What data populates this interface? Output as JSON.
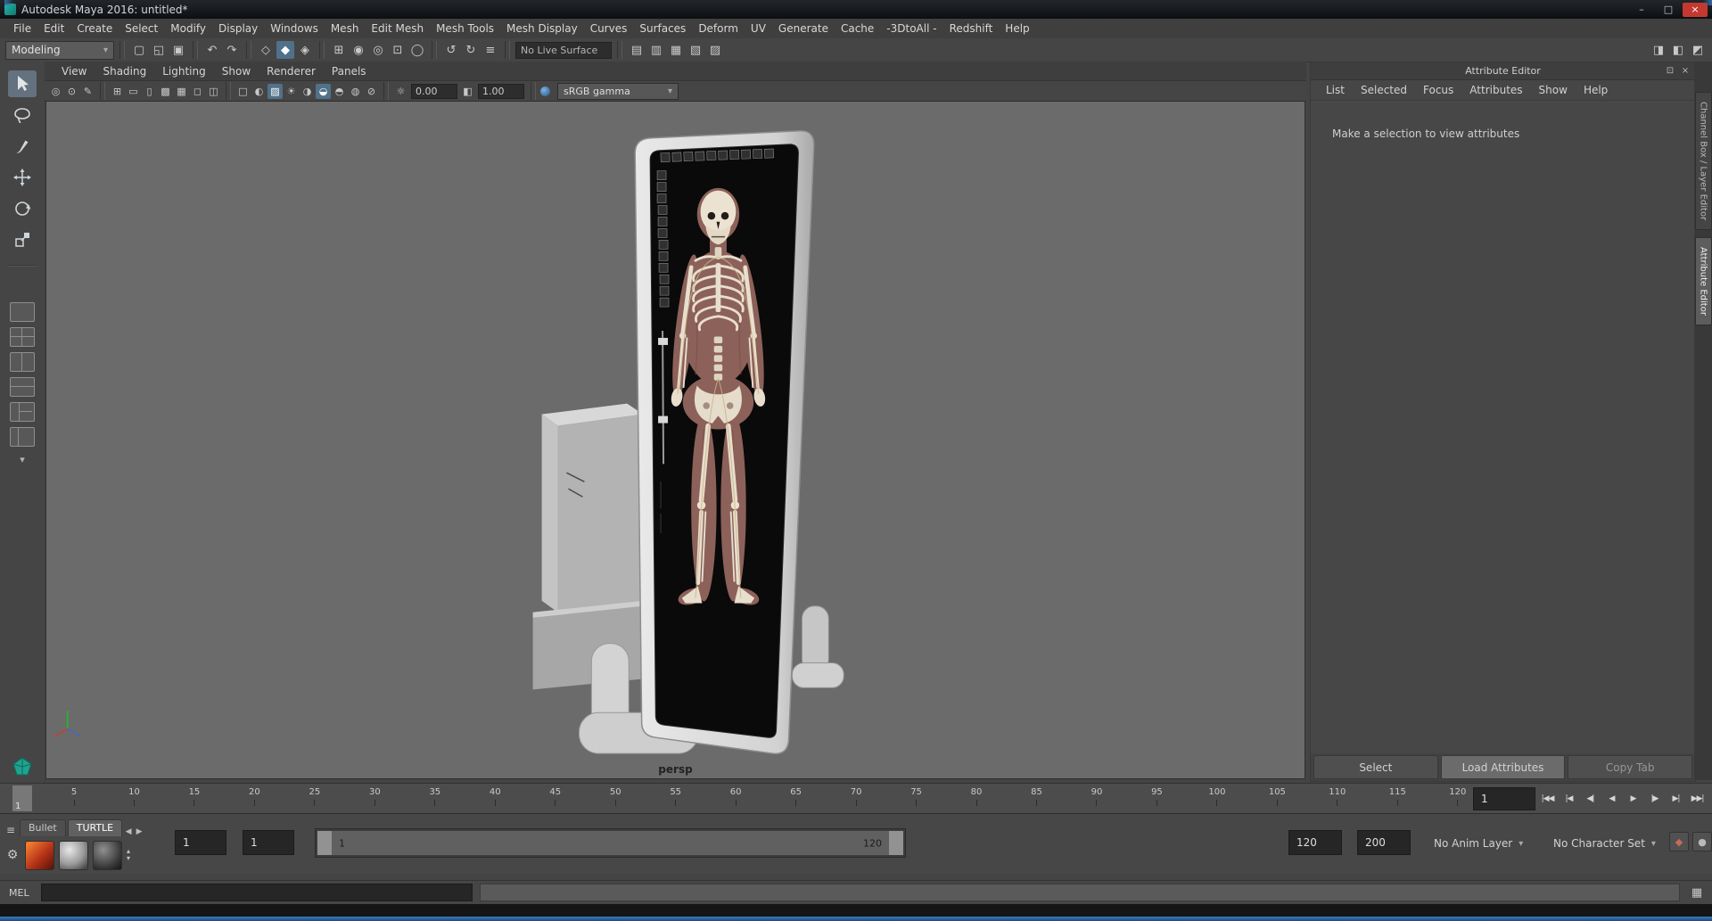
{
  "window": {
    "title": "Autodesk Maya 2016: untitled*"
  },
  "colors": {
    "ui_bg": "#444444",
    "viewport_bg": "#6b6b6b",
    "highlight": "#50718a",
    "close_red": "#c3392f"
  },
  "menubar": {
    "items": [
      "File",
      "Edit",
      "Create",
      "Select",
      "Modify",
      "Display",
      "Windows",
      "Mesh",
      "Edit Mesh",
      "Mesh Tools",
      "Mesh Display",
      "Curves",
      "Surfaces",
      "Deform",
      "UV",
      "Generate",
      "Cache",
      "-3DtoAll -",
      "Redshift",
      "Help"
    ]
  },
  "statusline": {
    "menuset": "Modeling",
    "live_surface": "No Live Surface"
  },
  "panel_menu": {
    "items": [
      "View",
      "Shading",
      "Lighting",
      "Show",
      "Renderer",
      "Panels"
    ]
  },
  "viewport_bar": {
    "exposure": "0.00",
    "gamma": "1.00",
    "colorspace": "sRGB gamma"
  },
  "viewport": {
    "camera": "persp"
  },
  "attribute_editor": {
    "title": "Attribute Editor",
    "menu": [
      "List",
      "Selected",
      "Focus",
      "Attributes",
      "Show",
      "Help"
    ],
    "message": "Make a selection to view attributes",
    "buttons": {
      "select": "Select",
      "load": "Load Attributes",
      "copy": "Copy Tab"
    }
  },
  "side_tabs": {
    "channel_box": "Channel Box / Layer Editor",
    "attribute_editor": "Attribute Editor"
  },
  "timeline": {
    "current": "1",
    "frame_field": "1",
    "ticks": [
      "5",
      "10",
      "15",
      "20",
      "25",
      "30",
      "35",
      "40",
      "45",
      "50",
      "55",
      "60",
      "65",
      "70",
      "75",
      "80",
      "85",
      "90",
      "95",
      "100",
      "105",
      "110",
      "115",
      "120"
    ]
  },
  "range": {
    "anim_start": "1",
    "play_start": "1",
    "range_label_start": "1",
    "range_label_end": "120",
    "play_end": "120",
    "anim_end": "200",
    "anim_layer": "No Anim Layer",
    "character_set": "No Character Set"
  },
  "shelf": {
    "tabs": [
      "Bullet",
      "TURTLE"
    ]
  },
  "command_line": {
    "label": "MEL"
  },
  "icons": {
    "minimize": "–",
    "maximize": "□",
    "close": "×",
    "chevron": "▾",
    "new_scene": "▢",
    "open_scene": "◱",
    "save_scene": "▣",
    "undo": "↶",
    "redo": "↷",
    "select_hierarchy": "◇",
    "select_object": "◆",
    "select_component": "◈",
    "snap_grid": "⊞",
    "snap_curve": "◉",
    "snap_point": "◎",
    "snap_view_plane": "⊡",
    "make_live": "◯",
    "inputs": "↺",
    "outputs": "↻",
    "construction_history": "≡",
    "counter_1": "▤",
    "counter_2": "▥",
    "counter_3": "▦",
    "counter_4": "▧",
    "counter_5": "▨",
    "sidebar_attribute_editor": "◨",
    "sidebar_tool_settings": "◧",
    "sidebar_channel_box": "◩",
    "vp_select_camera": "◎",
    "vp_lock_camera": "⊙",
    "vp_grease_pencil": "✎",
    "vp_grid": "⊞",
    "vp_film_gate": "▭",
    "vp_resolution_gate": "▯",
    "vp_gate_mask": "▩",
    "vp_field_chart": "▦",
    "vp_safe_action": "◻",
    "vp_safe_title": "◫",
    "vp_wireframe": "□",
    "vp_shaded": "◐",
    "vp_textured": "▨",
    "vp_lights": "☀",
    "vp_shadows": "◑",
    "vp_ao": "◒",
    "vp_motion_blur": "◓",
    "vp_xray": "◍",
    "vp_isolate": "⊘",
    "vp_exposure": "☼",
    "vp_gamma": "◧",
    "go_start": "|◀◀",
    "step_back_frame": "|◀",
    "step_back_key": "◀|",
    "play_back": "◀",
    "play_fwd": "▶",
    "step_fwd_key": "|▶",
    "step_fwd_frame": "▶|",
    "go_end": "▶▶|",
    "anim_layer_btn": "◆",
    "mute_btn": "●",
    "shelf_menu": "≡",
    "shelf_prev": "◀",
    "shelf_next": "▶",
    "gear": "⚙",
    "spin_up": "▴",
    "spin_down": "▾",
    "script_editor": "▦",
    "ae_float": "⊡",
    "ae_close": "×"
  }
}
